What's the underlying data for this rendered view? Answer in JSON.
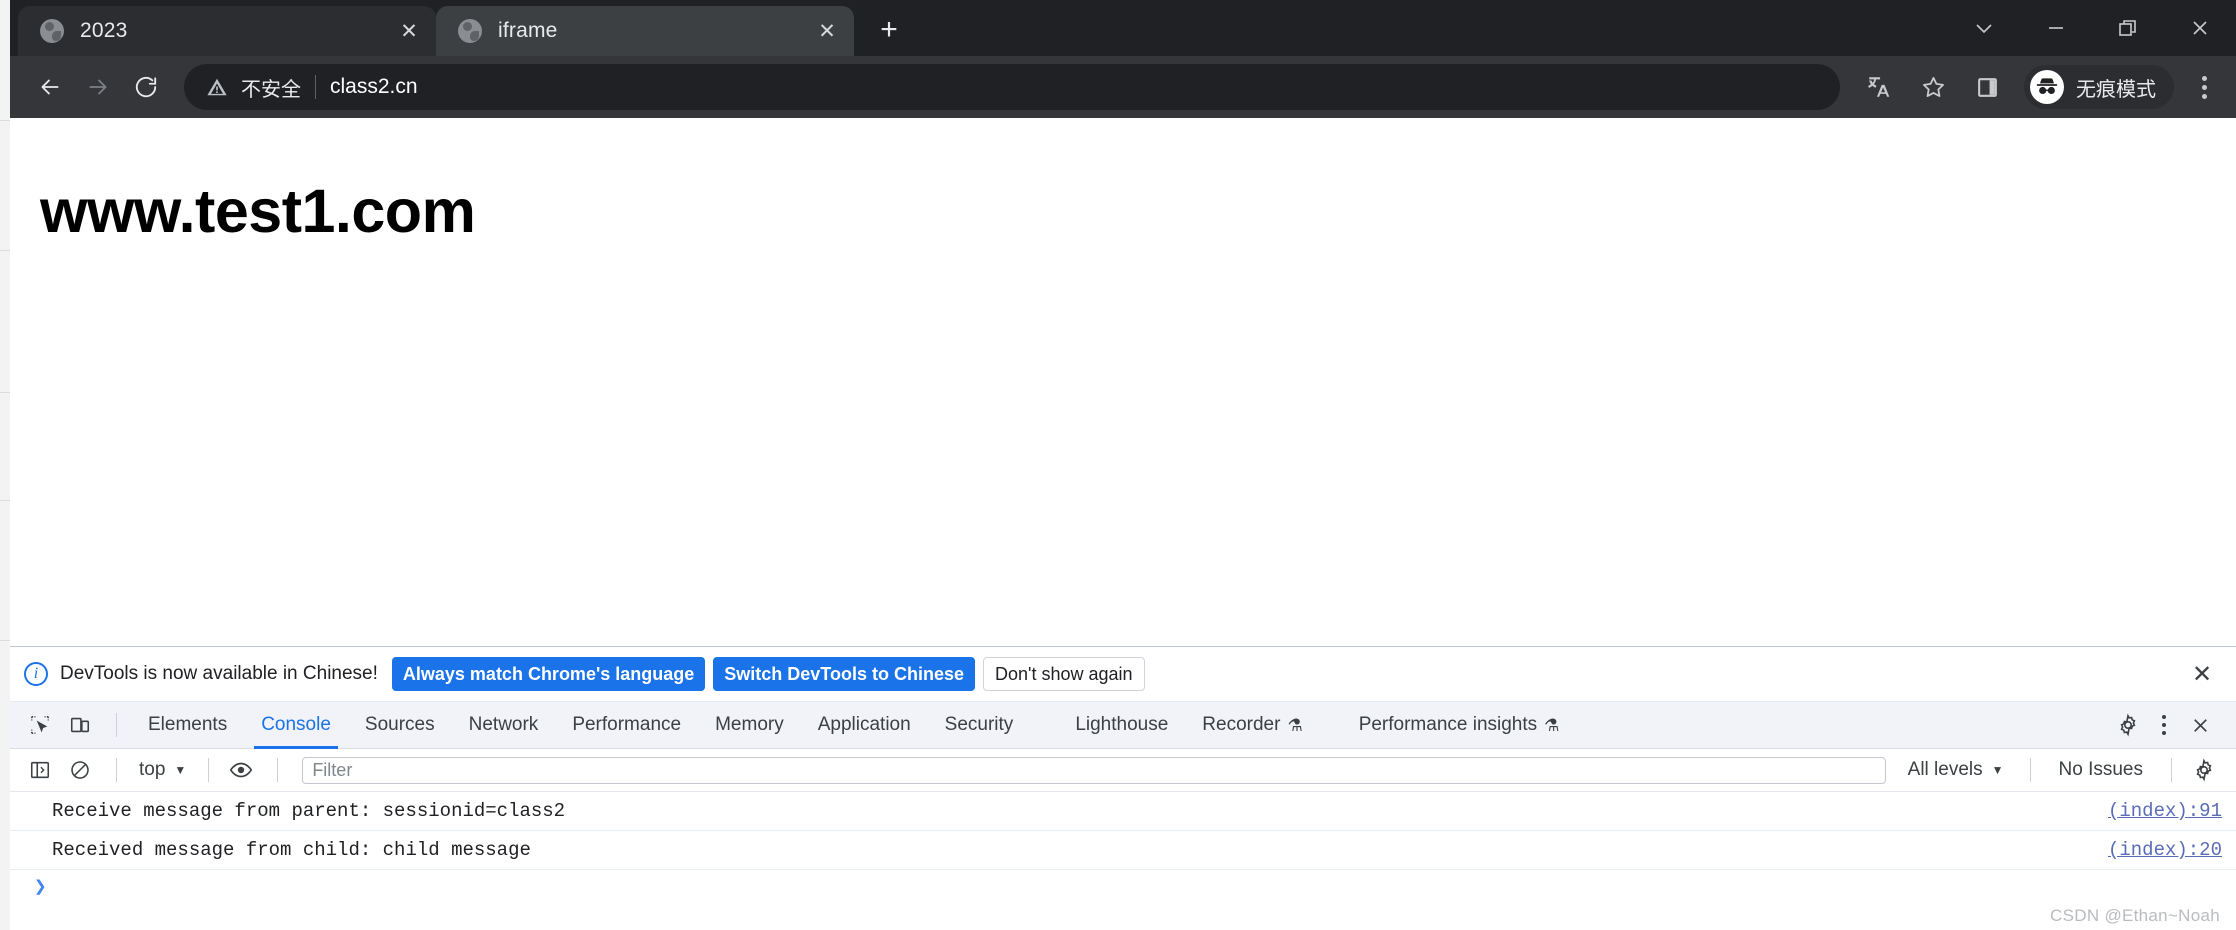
{
  "browser": {
    "tabs": [
      {
        "title": "2023",
        "active": false,
        "favicon": "globe-icon",
        "close": "✕"
      },
      {
        "title": "iframe",
        "active": true,
        "favicon": "globe-icon",
        "close": "✕"
      }
    ],
    "new_tab_label": "+",
    "window_controls": {
      "chevron": "chevron-down-icon",
      "minimize": "minimize-icon",
      "restore": "restore-icon",
      "close": "close-icon"
    },
    "toolbar": {
      "back": "back-arrow-icon",
      "forward": "forward-arrow-icon",
      "reload": "reload-icon",
      "security_warning": "不安全",
      "url": "class2.cn",
      "translate_icon": "translate-icon",
      "bookmark_icon": "star-icon",
      "side_panel_icon": "side-panel-icon",
      "incognito_label": "无痕模式",
      "menu_icon": "three-dot-menu-icon"
    }
  },
  "page": {
    "heading": "www.test1.com"
  },
  "devtools": {
    "notification": {
      "message": "DevTools is now available in Chinese!",
      "primary_button": "Always match Chrome's language",
      "secondary_button": "Switch DevTools to Chinese",
      "dismiss_button": "Don't show again",
      "close": "✕"
    },
    "tabs": [
      {
        "label": "Elements",
        "active": false,
        "flask": false
      },
      {
        "label": "Console",
        "active": true,
        "flask": false
      },
      {
        "label": "Sources",
        "active": false,
        "flask": false
      },
      {
        "label": "Network",
        "active": false,
        "flask": false
      },
      {
        "label": "Performance",
        "active": false,
        "flask": false
      },
      {
        "label": "Memory",
        "active": false,
        "flask": false
      },
      {
        "label": "Application",
        "active": false,
        "flask": false
      },
      {
        "label": "Security",
        "active": false,
        "flask": false
      },
      {
        "label": "Lighthouse",
        "active": false,
        "flask": false
      },
      {
        "label": "Recorder",
        "active": false,
        "flask": true
      },
      {
        "label": "Performance insights",
        "active": false,
        "flask": true
      }
    ],
    "flask_glyph": "⚗",
    "tabbar_right": {
      "settings": "gear-icon",
      "more": "three-dot-menu-icon",
      "close": "✕"
    },
    "console_toolbar": {
      "sidebar_icon": "console-sidebar-icon",
      "clear_icon": "clear-console-icon",
      "context": "top",
      "context_caret": "▼",
      "eye_icon": "live-expression-icon",
      "filter_placeholder": "Filter",
      "level": "All levels",
      "level_caret": "▼",
      "issues": "No Issues",
      "settings_icon": "gear-icon"
    },
    "console_messages": [
      {
        "text": "Receive message from parent: sessionid=class2",
        "source": "(index):91"
      },
      {
        "text": "Received message from child: child message",
        "source": "(index):20"
      }
    ],
    "prompt_caret": "❯"
  },
  "watermark": "CSDN @Ethan~Noah",
  "colors": {
    "chrome_bg": "#202124",
    "toolbar_bg": "#35363a",
    "active_tab": "#3c4043",
    "accent_blue": "#1a73e8",
    "devtools_bg": "#ffffff"
  }
}
